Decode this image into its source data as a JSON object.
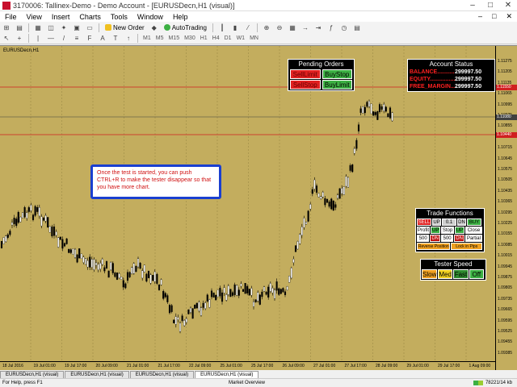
{
  "window": {
    "title": "3170006: Tallinex-Demo - Demo Account - [EURUSDecn,H1 (visual)]",
    "controls": [
      "–",
      "□",
      "✕"
    ]
  },
  "menu": {
    "items": [
      "File",
      "View",
      "Insert",
      "Charts",
      "Tools",
      "Window",
      "Help"
    ],
    "right": [
      "–",
      "□",
      "✕"
    ]
  },
  "toolbar": {
    "new_order": "New Order",
    "autotrading": "AutoTrading",
    "timeframes": [
      "M1",
      "M5",
      "M15",
      "M30",
      "H1",
      "H4",
      "D1",
      "W1",
      "MN"
    ]
  },
  "chart": {
    "symbol": "EURUSDecn,H1",
    "bg": "#c3ad5e",
    "candle_color": "#000000",
    "level_color": "#d02020",
    "price_ticks": [
      "1.11275",
      "1.11205",
      "1.11135",
      "1.11065",
      "1.10995",
      "1.10925",
      "1.10855",
      "1.10785",
      "1.10715",
      "1.10645",
      "1.10575",
      "1.10505",
      "1.10435",
      "1.10365",
      "1.10295",
      "1.10225",
      "1.10155",
      "1.10085",
      "1.10015",
      "1.09945",
      "1.09875",
      "1.09805",
      "1.09735",
      "1.09665",
      "1.09595",
      "1.09525",
      "1.09455",
      "1.09385"
    ],
    "price_tags": [
      {
        "value": "1.11550",
        "color": "#d02020"
      },
      {
        "value": "1.11080",
        "color": "#404040"
      },
      {
        "value": "1.10440",
        "color": "#d02020"
      }
    ],
    "time_ticks": [
      "18 Jul 2016",
      "19 Jul 01:00",
      "19 Jul 17:00",
      "20 Jul 09:00",
      "21 Jul 01:00",
      "21 Jul 17:00",
      "22 Jul 09:00",
      "25 Jul 01:00",
      "25 Jul 17:00",
      "26 Jul 09:00",
      "27 Jul 01:00",
      "27 Jul 17:00",
      "28 Jul 09:00",
      "29 Jul 01:00",
      "29 Jul 17:00",
      "1 Aug 09:00"
    ]
  },
  "pending_orders": {
    "title": "Pending Orders",
    "sell_limit": "SellLimit",
    "buy_stop": "BuyStop",
    "sell_stop": "SellStop",
    "buy_limit": "BuyLimit"
  },
  "account_status": {
    "title": "Account Status",
    "rows": [
      {
        "label": "BALANCE..................",
        "value": "299997.50"
      },
      {
        "label": "EQUITY.....................",
        "value": "299997.50"
      },
      {
        "label": "FREE_MARGIN................",
        "value": "299997.50"
      }
    ]
  },
  "note": {
    "text": "Once the test is started, you can push CTRL+R to make the tester disappear so that you have more chart."
  },
  "trade_functions": {
    "title": "Trade Functions",
    "row1": [
      "SELL",
      "UP",
      "0.1",
      "DN",
      "BUY"
    ],
    "row2": [
      "Profit",
      "UP",
      "Stop",
      "UP",
      "Close"
    ],
    "row3": [
      "500",
      "DN",
      "500",
      "DN",
      "Partial"
    ],
    "row4": [
      "Reverse Position",
      "Lock in Pips"
    ]
  },
  "tester_speed": {
    "title": "Tester Speed",
    "buttons": [
      "Slow",
      "Med",
      "Fast",
      "Off"
    ]
  },
  "tabs": [
    "EURUSDecn,H1 (visual)",
    "EURUSDecn,H1 (visual)",
    "EURUSDecn,H1 (visual)",
    "EURUSDecn,H1 (visual)"
  ],
  "status": {
    "help": "For Help, press F1",
    "profile": "Market Overview",
    "connection": "78221/14 kb"
  }
}
